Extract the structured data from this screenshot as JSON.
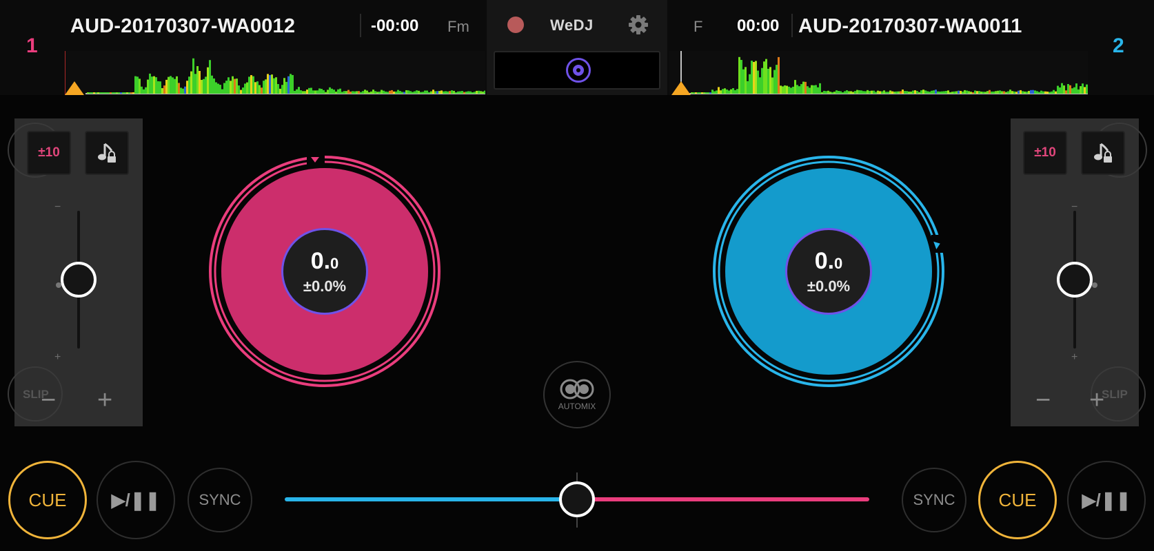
{
  "app": {
    "name": "WeDJ"
  },
  "colors": {
    "deck1": "#ea3d7d",
    "deck2": "#29b5ea",
    "platter1": "#cc2e6c",
    "platter2": "#149bcc",
    "cue": "#f0b43a",
    "accent": "#6f52e8"
  },
  "header": {
    "record_icon": "record-icon",
    "logo": "WeDJ",
    "settings_icon": "gear-icon",
    "center_icon": "target-icon"
  },
  "deck1": {
    "number": "1",
    "title": "AUD-20170307-WA0012",
    "time": "-00:00",
    "key": "Fm",
    "pitch_range": "±10",
    "key_lock_icon": "note-lock-icon",
    "bpm_int": "0.",
    "bpm_dec": "0",
    "pitch": "±0.0%",
    "slip": "SLIP",
    "minus": "−",
    "plus": "+",
    "tempo_minus": "−",
    "tempo_plus": "+",
    "tempo_level": 0.5,
    "cue": "CUE",
    "play": "▶/❚❚",
    "sync": "SYNC"
  },
  "deck2": {
    "number": "2",
    "title": "AUD-20170307-WA0011",
    "time": "00:00",
    "key": "F",
    "pitch_range": "±10",
    "key_lock_icon": "note-lock-icon",
    "bpm_int": "0.",
    "bpm_dec": "0",
    "pitch": "±0.0%",
    "slip": "SLIP",
    "minus": "−",
    "plus": "+",
    "tempo_minus": "−",
    "tempo_plus": "+",
    "tempo_level": 0.5,
    "cue": "CUE",
    "play": "▶/❚❚",
    "sync": "SYNC"
  },
  "automix": {
    "label": "AUTOMIX"
  },
  "crossfader": {
    "position": 0.5
  }
}
